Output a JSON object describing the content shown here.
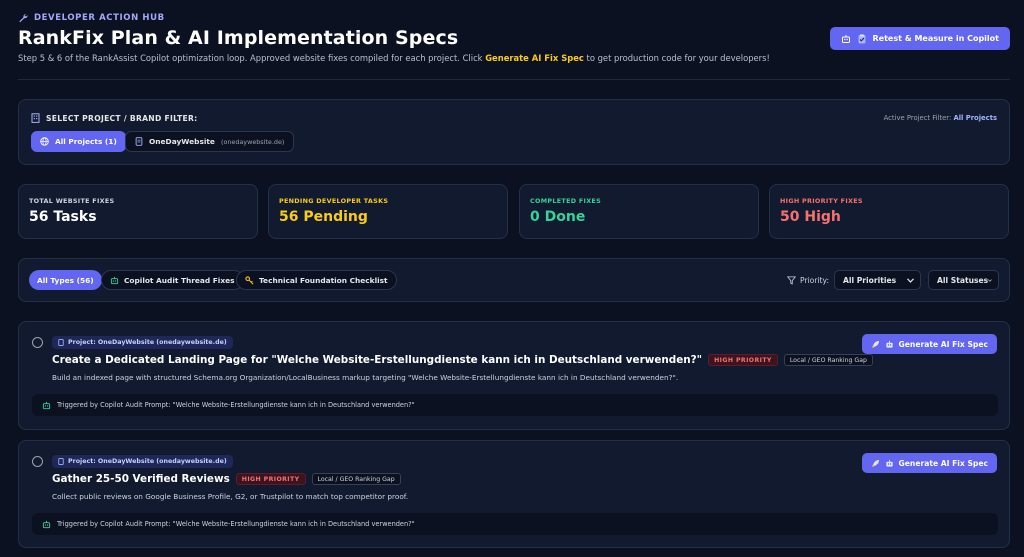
{
  "header": {
    "eyebrow": "DEVELOPER ACTION HUB",
    "title": "RankFix Plan & AI Implementation Specs",
    "subtitle_pre": "Step 5 & 6 of the RankAssist Copilot optimization loop. Approved website fixes compiled for each project. Click ",
    "subtitle_highlight": "Generate AI Fix Spec",
    "subtitle_post": " to get production code for your developers!",
    "retest_button": "Retest & Measure in Copilot"
  },
  "project_filter": {
    "label": "SELECT PROJECT / BRAND FILTER:",
    "active_label": "Active Project Filter:",
    "active_value": "All Projects",
    "chips": [
      {
        "label": "All Projects (1)"
      },
      {
        "label": "OneDayWebsite",
        "sub": "(onedaywebsite.de)"
      }
    ]
  },
  "stats": [
    {
      "label": "TOTAL WEBSITE FIXES",
      "value": "56 Tasks",
      "color": "#ffffff",
      "label_color": "#cbd5e1"
    },
    {
      "label": "PENDING DEVELOPER TASKS",
      "value": "56 Pending",
      "color": "#facc15",
      "label_color": "#facc15"
    },
    {
      "label": "COMPLETED FIXES",
      "value": "0 Done",
      "color": "#34d399",
      "label_color": "#34d399"
    },
    {
      "label": "HIGH PRIORITY FIXES",
      "value": "50 High",
      "color": "#f87171",
      "label_color": "#f87171"
    }
  ],
  "type_filter": {
    "chips": [
      {
        "label": "All Types (56)"
      },
      {
        "label": "Copilot Audit Thread Fixes"
      },
      {
        "label": "Technical Foundation Checklist"
      }
    ],
    "priority_label": "Priority:",
    "priority_select": "All Priorities",
    "status_select": "All Statuses"
  },
  "tasks": [
    {
      "project": "Project: OneDayWebsite (onedaywebsite.de)",
      "title": "Create a Dedicated Landing Page for \"Welche Website-Erstellungdienste kann ich in Deutschland verwenden?\"",
      "priority": "HIGH PRIORITY",
      "category": "Local / GEO Ranking Gap",
      "description": "Build an indexed page with structured Schema.org Organization/LocalBusiness markup targeting \"Welche Website-Erstellungdienste kann ich in Deutschland verwenden?\".",
      "trigger": "Triggered by Copilot Audit Prompt: \"Welche Website-Erstellungdienste kann ich in Deutschland verwenden?\"",
      "button": "Generate AI Fix Spec"
    },
    {
      "project": "Project: OneDayWebsite (onedaywebsite.de)",
      "title": "Gather 25-50 Verified Reviews",
      "priority": "HIGH PRIORITY",
      "category": "Local / GEO Ranking Gap",
      "description": "Collect public reviews on Google Business Profile, G2, or Trustpilot to match top competitor proof.",
      "trigger": "Triggered by Copilot Audit Prompt: \"Welche Website-Erstellungdienste kann ich in Deutschland verwenden?\"",
      "button": "Generate AI Fix Spec"
    }
  ],
  "colors": {
    "accent": "#6366f1",
    "background": "#0b1120",
    "panel": "#111a2e",
    "highlight": "#facc15",
    "high_priority": "#f87171"
  },
  "icons": [
    "wrench-icon",
    "clipboard-icon",
    "building-icon",
    "globe-icon",
    "file-icon",
    "robot-icon",
    "key-icon",
    "filter-icon",
    "chevron-down-icon",
    "rocket-icon"
  ]
}
